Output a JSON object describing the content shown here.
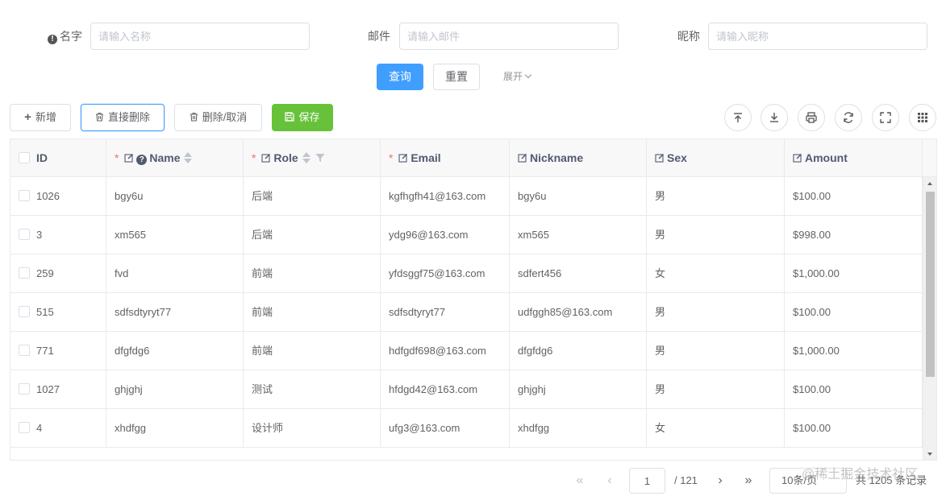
{
  "form": {
    "name_label": "名字",
    "name_placeholder": "请输入名称",
    "email_label": "邮件",
    "email_placeholder": "请输入邮件",
    "nickname_label": "昵称",
    "nickname_placeholder": "请输入昵称",
    "search_button": "查询",
    "reset_button": "重置",
    "expand_link": "展开"
  },
  "toolbar": {
    "add_button": "新增",
    "direct_delete_button": "直接删除",
    "delete_cancel_button": "删除/取消",
    "save_button": "保存",
    "icons": [
      "import-icon",
      "export-icon",
      "print-icon",
      "refresh-icon",
      "fullscreen-icon",
      "column-settings-icon"
    ]
  },
  "table": {
    "columns": {
      "id": "ID",
      "name": "Name",
      "role": "Role",
      "email": "Email",
      "nickname": "Nickname",
      "sex": "Sex",
      "amount": "Amount"
    },
    "rows": [
      {
        "id": "1026",
        "name": "bgy6u",
        "role": "后端",
        "email": "kgfhgfh41@163.com",
        "nickname": "bgy6u",
        "sex": "男",
        "amount": "$100.00"
      },
      {
        "id": "3",
        "name": "xm565",
        "role": "后端",
        "email": "ydg96@163.com",
        "nickname": "xm565",
        "sex": "男",
        "amount": "$998.00"
      },
      {
        "id": "259",
        "name": "fvd",
        "role": "前端",
        "email": "yfdsggf75@163.com",
        "nickname": "sdfert456",
        "sex": "女",
        "amount": "$1,000.00"
      },
      {
        "id": "515",
        "name": "sdfsdtyryt77",
        "role": "前端",
        "email": "sdfsdtyryt77",
        "nickname": "udfggh85@163.com",
        "sex": "男",
        "amount": "$100.00"
      },
      {
        "id": "771",
        "name": "dfgfdg6",
        "role": "前端",
        "email": "hdfgdf698@163.com",
        "nickname": "dfgfdg6",
        "sex": "男",
        "amount": "$1,000.00"
      },
      {
        "id": "1027",
        "name": "ghjghj",
        "role": "测试",
        "email": "hfdgd42@163.com",
        "nickname": "ghjghj",
        "sex": "男",
        "amount": "$100.00"
      },
      {
        "id": "4",
        "name": "xhdfgg",
        "role": "设计师",
        "email": "ufg3@163.com",
        "nickname": "xhdfgg",
        "sex": "女",
        "amount": "$100.00"
      }
    ]
  },
  "pager": {
    "current_page": "1",
    "total_pages": "/ 121",
    "page_size": "10条/页",
    "total_records": "共 1205 条记录"
  },
  "watermark": "@稀土掘金技术社区",
  "colors": {
    "primary": "#409eff",
    "success": "#67c23a",
    "required_star": "#f56c6c",
    "header_bg": "#f8f8f9",
    "border": "#e8eaec"
  }
}
